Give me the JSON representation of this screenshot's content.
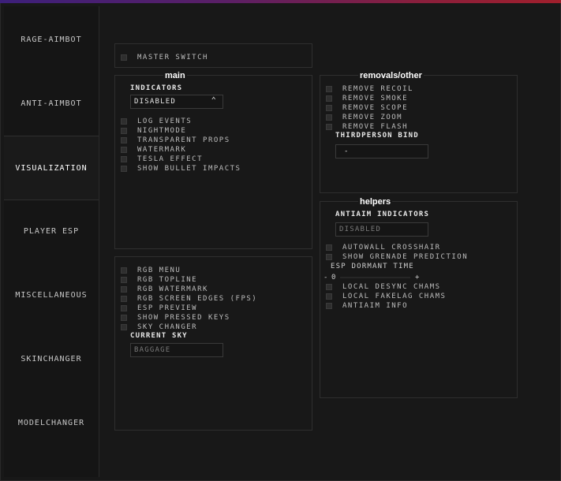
{
  "sidebar": {
    "tabs": [
      {
        "label": "RAGE-AIMBOT"
      },
      {
        "label": "ANTI-AIMBOT"
      },
      {
        "label": "VISUALIZATION",
        "active": true
      },
      {
        "label": "PLAYER ESP"
      },
      {
        "label": "MISCELLANEOUS"
      },
      {
        "label": "SKINCHANGER"
      },
      {
        "label": "MODELCHANGER"
      }
    ]
  },
  "colors": {
    "topline_start": "#3c1f7a",
    "topline_end": "#a01f2c",
    "background": "#181818",
    "panel_border": "#2f2f2f"
  },
  "master": {
    "label": "MASTER SWITCH"
  },
  "main": {
    "title": "main",
    "indicators_label": "INDICATORS",
    "indicators_value": "DISABLED",
    "options": [
      "LOG EVENTS",
      "NIGHTMODE",
      "TRANSPARENT PROPS",
      "WATERMARK",
      "TESLA EFFECT",
      "SHOW BULLET IMPACTS"
    ]
  },
  "misc": {
    "options": [
      "RGB MENU",
      "RGB TOPLINE",
      "RGB WATERMARK",
      "RGB SCREEN EDGES (FPS)",
      "ESP PREVIEW",
      "SHOW PRESSED KEYS",
      "SKY CHANGER"
    ],
    "current_sky_label": "CURRENT SKY",
    "current_sky_value": "BAGGAGE"
  },
  "removals": {
    "title": "removals/other",
    "options": [
      "REMOVE RECOIL",
      "REMOVE SMOKE",
      "REMOVE SCOPE",
      "REMOVE ZOOM",
      "REMOVE FLASH"
    ],
    "thirdperson_label": "THIRDPERSON BIND",
    "thirdperson_value": "-"
  },
  "helpers": {
    "title": "helpers",
    "antiaim_label": "ANTIAIM INDICATORS",
    "antiaim_value": "DISABLED",
    "options_a": [
      "AUTOWALL CROSSHAIR",
      "SHOW GRENADE PREDICTION"
    ],
    "esp_dormant_label": "ESP DORMANT TIME",
    "esp_dormant_minus": "-",
    "esp_dormant_value": "0",
    "esp_dormant_plus": "+",
    "options_b": [
      "LOCAL DESYNC CHAMS",
      "LOCAL FAKELAG CHAMS",
      "ANTIAIM INFO"
    ]
  }
}
